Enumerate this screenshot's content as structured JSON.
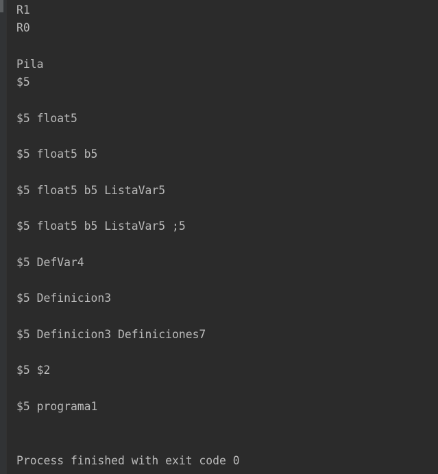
{
  "console": {
    "lines": [
      "R1",
      "R0",
      "",
      "Pila",
      "$5",
      "",
      "$5 float5",
      "",
      "$5 float5 b5",
      "",
      "$5 float5 b5 ListaVar5",
      "",
      "$5 float5 b5 ListaVar5 ;5",
      "",
      "$5 DefVar4",
      "",
      "$5 Definicion3",
      "",
      "$5 Definicion3 Definiciones7",
      "",
      "$5 $2",
      "",
      "$5 programa1",
      "",
      "",
      "Process finished with exit code 0"
    ]
  },
  "colors": {
    "background": "#2b2b2b",
    "text": "#bbbbbb"
  }
}
